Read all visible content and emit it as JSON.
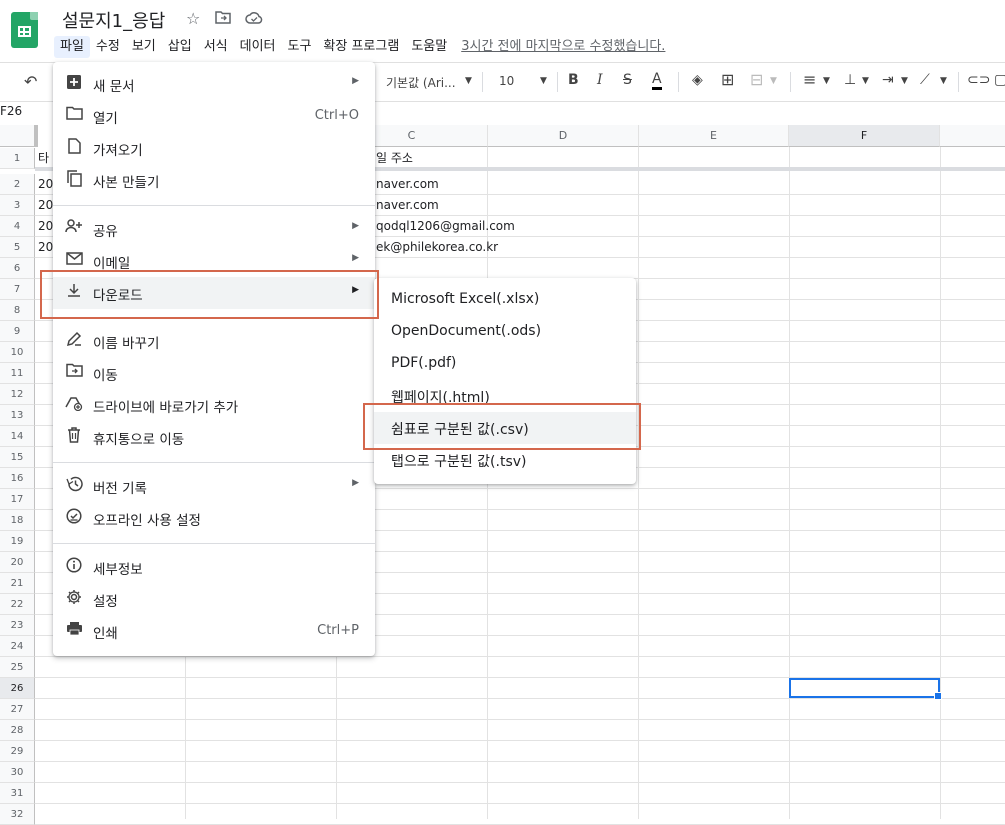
{
  "doc": {
    "title": "설문지1_응답"
  },
  "menubar": {
    "items": [
      "파일",
      "수정",
      "보기",
      "삽입",
      "서식",
      "데이터",
      "도구",
      "확장 프로그램",
      "도움말"
    ],
    "last_edit": "3시간 전에 마지막으로 수정했습니다."
  },
  "toolbar": {
    "font": "기본값 (Ari...",
    "size": "10"
  },
  "namebox": "F26",
  "columns": [
    "C",
    "D",
    "E",
    "F"
  ],
  "rows": [
    "1",
    "2",
    "3",
    "4",
    "5",
    "6",
    "7",
    "8",
    "9",
    "10",
    "11",
    "12",
    "13",
    "14",
    "15",
    "16",
    "17",
    "18",
    "19",
    "20",
    "21",
    "22",
    "23",
    "24",
    "25",
    "26",
    "27",
    "28",
    "29",
    "30",
    "31",
    "32"
  ],
  "cells": {
    "a1": "타",
    "a2": "20",
    "a3": "20",
    "a4": "20",
    "a5": "20",
    "c1": "일 주소",
    "c2": "naver.com",
    "c3": "naver.com",
    "c4": "qodql1206@gmail.com",
    "c5": "ek@philekorea.co.kr"
  },
  "file_menu": {
    "new": "새 문서",
    "open": "열기",
    "open_shortcut": "Ctrl+O",
    "import": "가져오기",
    "copy": "사본 만들기",
    "share": "공유",
    "email": "이메일",
    "download": "다운로드",
    "rename": "이름 바꾸기",
    "move": "이동",
    "shortcut": "드라이브에 바로가기 추가",
    "trash": "휴지통으로 이동",
    "version": "버전 기록",
    "offline": "오프라인 사용 설정",
    "details": "세부정보",
    "settings": "설정",
    "print": "인쇄",
    "print_shortcut": "Ctrl+P"
  },
  "download_menu": [
    "Microsoft Excel(.xlsx)",
    "OpenDocument(.ods)",
    "PDF(.pdf)",
    "웹페이지(.html)",
    "쉼표로 구분된 값(.csv)",
    "탭으로 구분된 값(.tsv)"
  ],
  "colors": {
    "accent": "#1a73e8",
    "sheets_green": "#23a566",
    "highlight_box": "#d4674c"
  }
}
